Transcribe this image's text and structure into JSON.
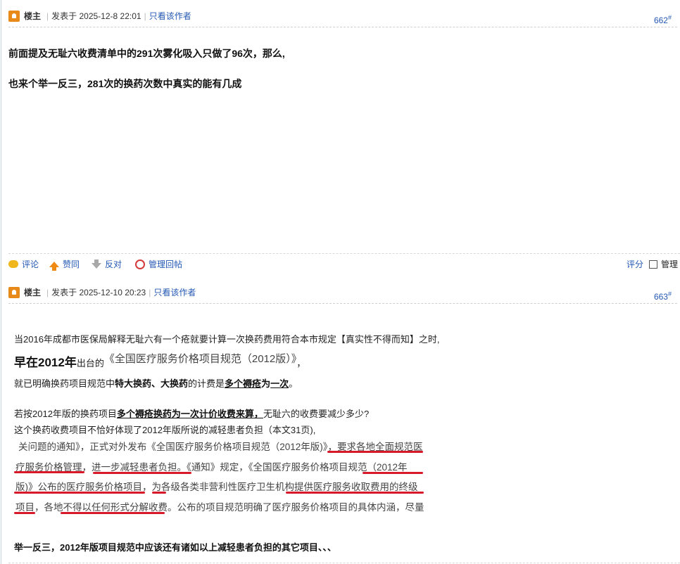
{
  "posts": [
    {
      "author": "楼主",
      "posted_label": "发表于",
      "date": "2025-12-8 22:01",
      "only_author": "只看该作者",
      "floor": "662",
      "floor_mark": "#",
      "lines": [
        "前面提及无耻六收费清单中的291次雾化吸入只做了96次，那么,",
        "也来个举一反三，281次的换药次数中真实的能有几成"
      ]
    },
    {
      "author": "楼主",
      "posted_label": "发表于",
      "date": "2025-12-10 20:23",
      "only_author": "只看该作者",
      "floor": "663",
      "floor_mark": "#",
      "para1": "当2016年成都市医保局解释无耻六有一个疮就要计算一次换药费用符合本市规定【真实性不得而知】之时,",
      "para2_lead": "早在2012年",
      "para2_mid": "出台的",
      "para2_title": "《全国医疗服务价格项目规范（2012版）》",
      "para2_end": "，",
      "para3_a": "就已明确换药项目规范中",
      "para3_b": "特大换药、大换药",
      "para3_c": "的计费是",
      "para3_d": "多个褥疮",
      "para3_e": "为",
      "para3_f": "一次",
      "para3_g": "。",
      "para4_a": "若按2012年版的换药项目",
      "para4_b": "多个褥疮换药为一次计价收费来算，",
      "para4_c": "无耻六的收费要减少多少?",
      "para5": "这个换药收费项目不恰好体现了2012年版所说的减轻患者负担（本文31页),",
      "image_lines": [
        "关问题的通知》，正式对外发布《全国医疗服务价格项目规范（2012年版)》，要求各地全面规范医",
        "疗服务价格管理，进一步减轻患者负担。《通知》规定，《全国医疗服务价格项目规范（2012年",
        "版)》公布的医疗服务价格项目，为各级各类非营利性医疗卫生机构提供医疗服务收取费用的终级",
        "项目，各地不得以任何形式分解收费。公布的项目规范明确了医疗服务价格项目的具体内涵，尽量"
      ],
      "para6": "举一反三，2012年版项目规范中应该还有诸如以上减轻患者负担的其它项目、、、"
    }
  ],
  "actions": {
    "comment": "评论",
    "agree": "赞同",
    "oppose": "反对",
    "manage": "管理回帖",
    "rate": "评分",
    "admin": "管理"
  },
  "colors": {
    "link": "#2458b3",
    "underline_red": "#d8192a",
    "avatar": "#e88a1a"
  }
}
